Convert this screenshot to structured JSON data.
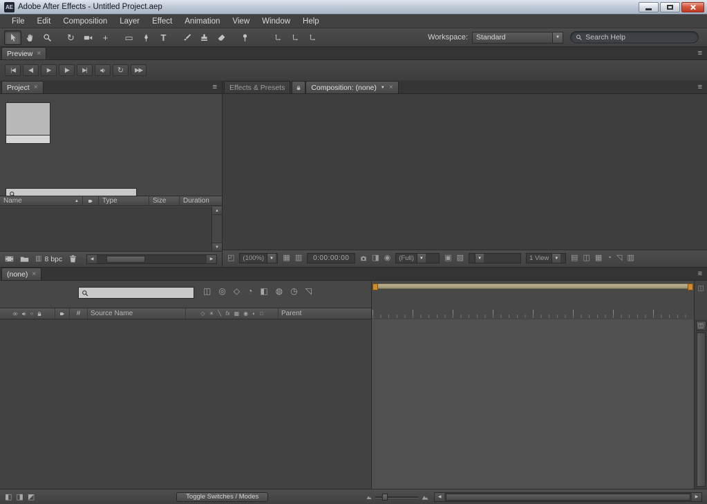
{
  "window": {
    "icon_text": "AE",
    "title": "Adobe After Effects - Untitled Project.aep"
  },
  "menubar": {
    "items": [
      "File",
      "Edit",
      "Composition",
      "Layer",
      "Effect",
      "Animation",
      "View",
      "Window",
      "Help"
    ]
  },
  "toolbar": {
    "workspace_label": "Workspace:",
    "workspace_value": "Standard",
    "search_placeholder": "Search Help"
  },
  "preview_panel": {
    "tab_label": "Preview"
  },
  "project_panel": {
    "tab_label": "Project",
    "search_value": "",
    "columns": {
      "name": "Name",
      "type": "Type",
      "size": "Size",
      "duration": "Duration"
    },
    "bit_depth": "8 bpc",
    "rows": []
  },
  "effects_panel": {
    "tab_label": "Effects & Presets"
  },
  "composition_panel": {
    "tab_label": "Composition: (none)",
    "magnification": "(100%)",
    "timecode": "0:00:00:00",
    "resolution": "(Full)",
    "view_layout": "1 View"
  },
  "timeline_panel": {
    "tab_label": "(none)",
    "search_value": "",
    "columns": {
      "number": "#",
      "source_name": "Source Name",
      "parent": "Parent"
    },
    "toggle_switches_label": "Toggle Switches / Modes",
    "rows": []
  },
  "colors": {
    "close_button": "#c23a26",
    "work_area_bar": "#b3a27c",
    "work_area_marker": "#cf8a30"
  },
  "glyphs": {
    "close": "×",
    "panel_menu": "≡",
    "dropdown": "▼",
    "sort": "▲",
    "left": "◀",
    "right": "▶",
    "up": "▲",
    "down": "▼",
    "first_frame": "|◀",
    "prev_frame": "◀|",
    "play": "▶",
    "next_frame": "|▶",
    "last_frame": "▶|",
    "loop": "↻",
    "ram_preview": "▶▶",
    "rotation": "↻",
    "pan_behind": "+",
    "rect_tool": "▭",
    "type_tool": "T",
    "solo": "○",
    "comp_icons": {
      "expand": "◰",
      "grid": "▦",
      "safe": "▥",
      "show_snapshot": "◨",
      "channels": "◉",
      "roi": "▣",
      "transparency": "▨",
      "pixel_aspect": "▤",
      "fast_previews": "◫",
      "timeline_btn": "▦",
      "flow": "◔",
      "reset_exposure": "◹",
      "exposure": "▥"
    },
    "tl_toolbar_icons": [
      "◫",
      "◎",
      "◇",
      "◔",
      "◧",
      "◍",
      "◷",
      "◹"
    ],
    "switch_icons": [
      "◇",
      "☀",
      "╲",
      "fx",
      "▦",
      "◉",
      "◐",
      "□"
    ],
    "tl_corner_icon": "◫",
    "tl_bottom_icons": [
      "◧",
      "◨",
      "◩"
    ],
    "bit_depth_icon": "▥"
  }
}
